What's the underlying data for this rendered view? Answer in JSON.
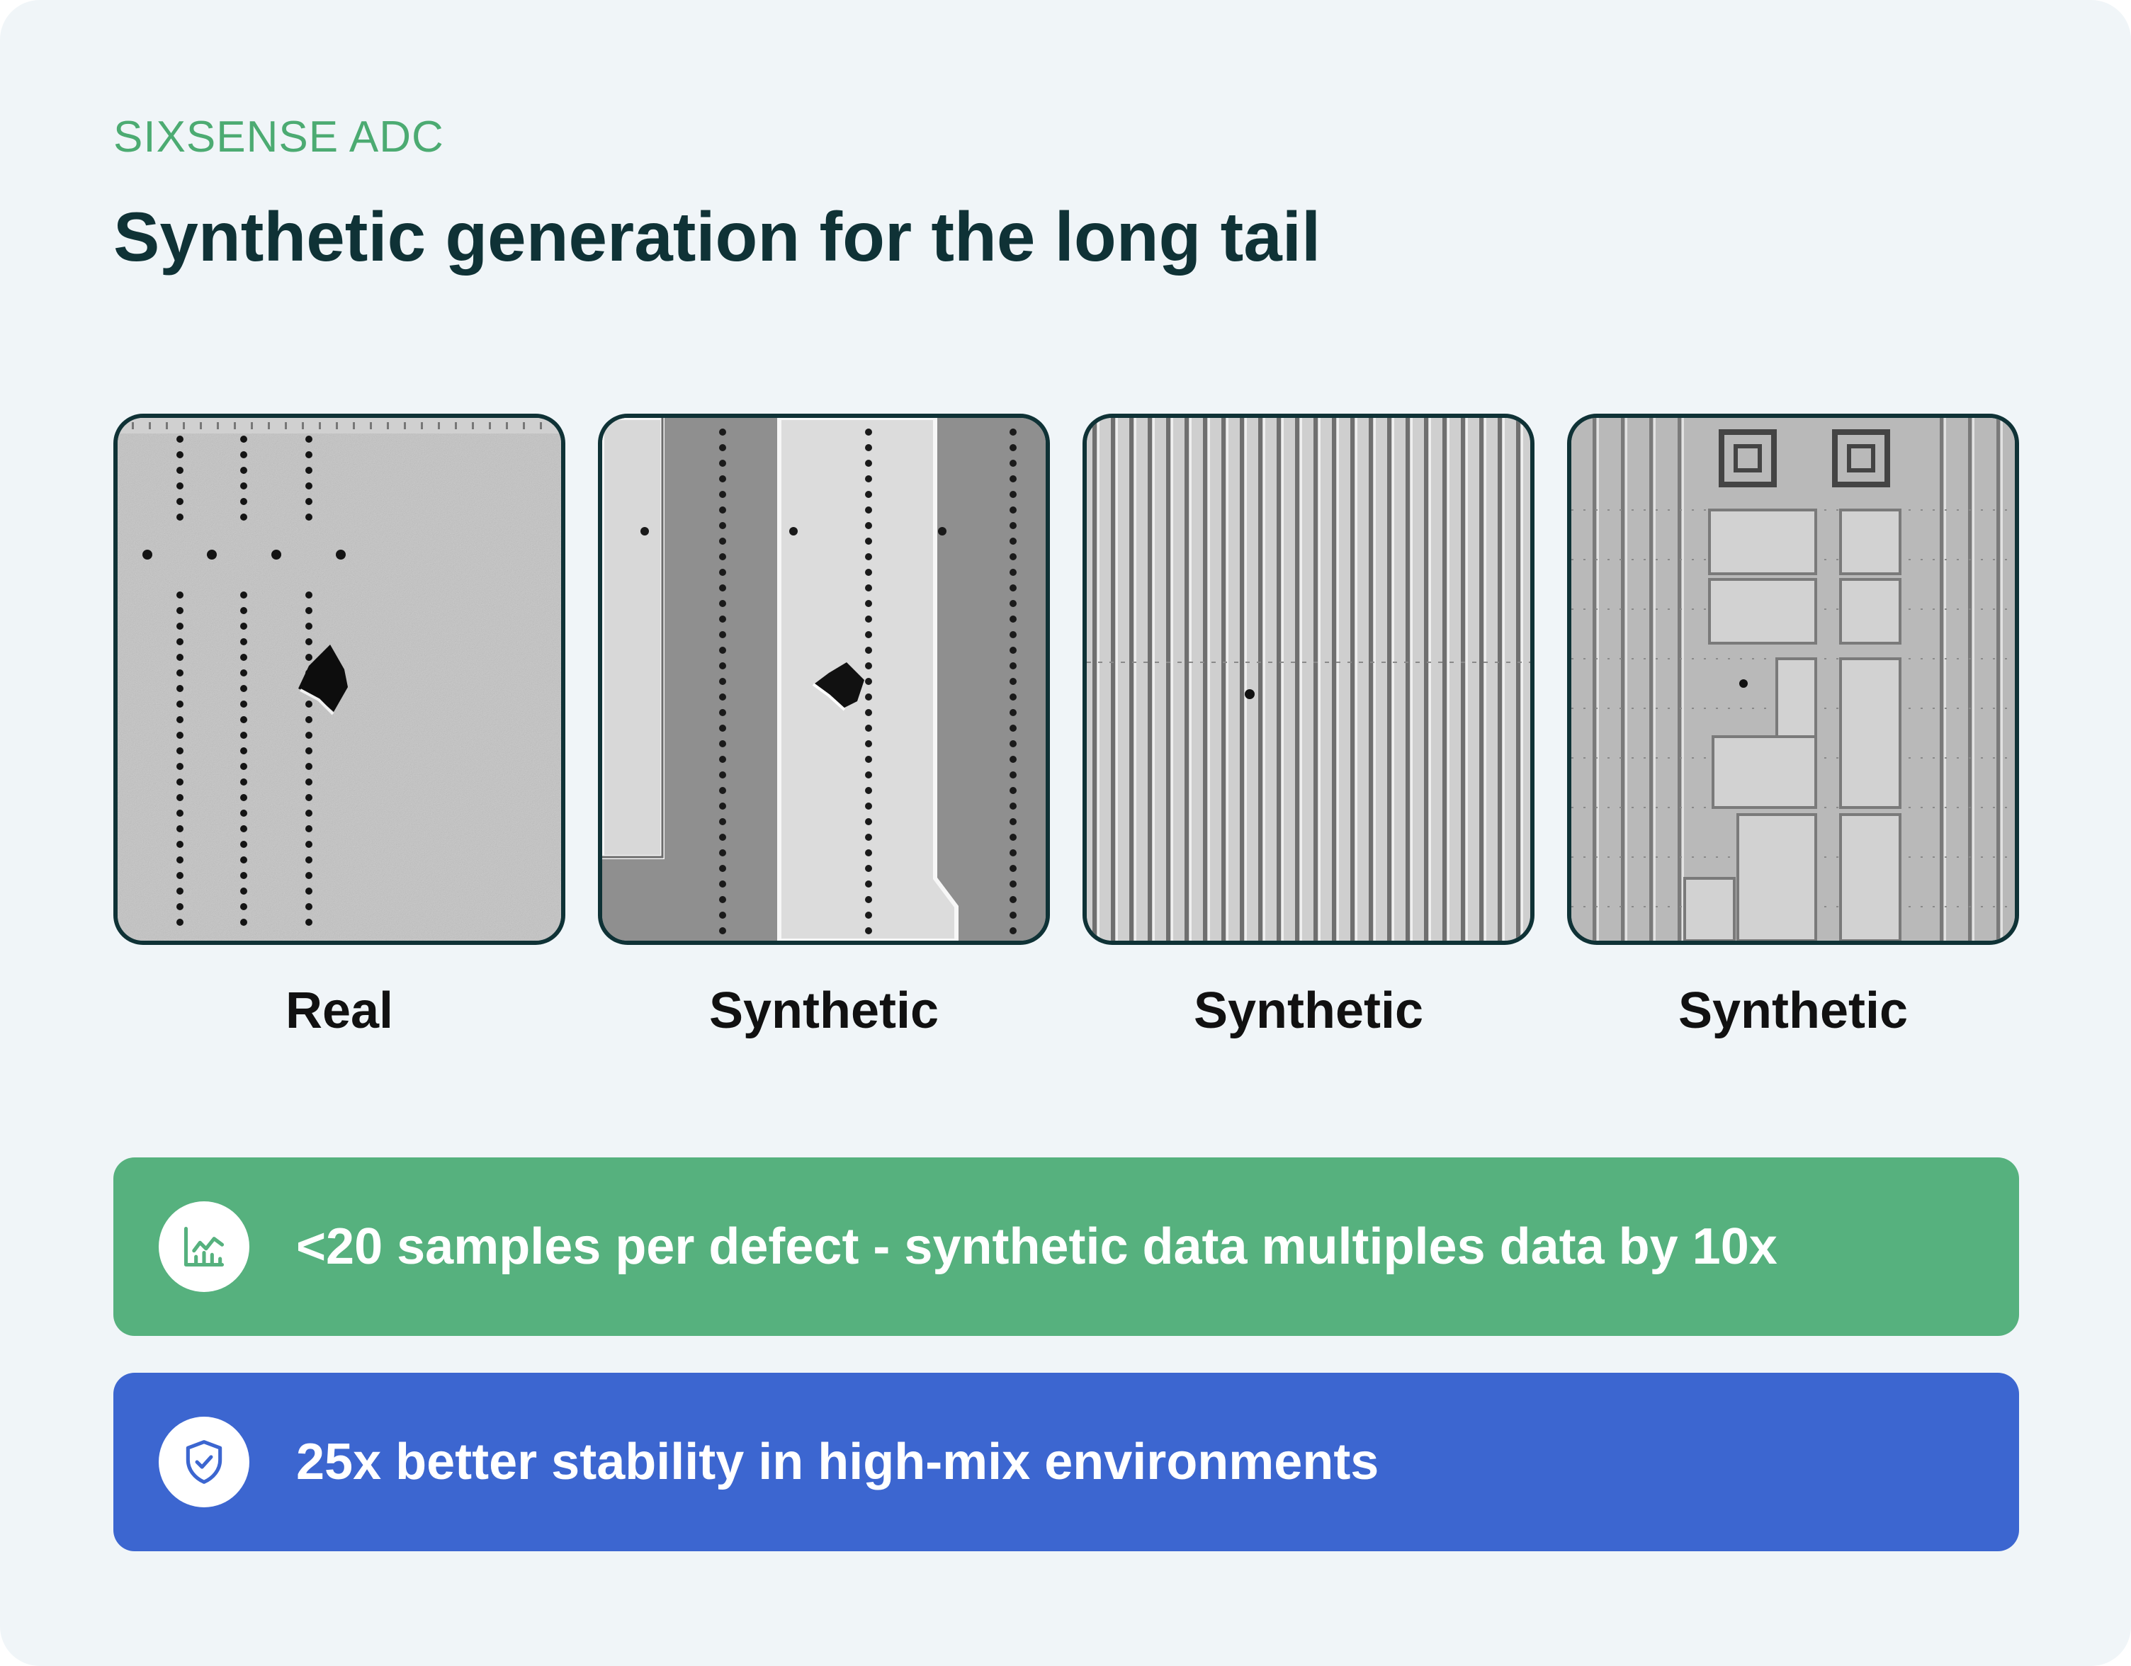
{
  "header": {
    "eyebrow": "SIXSENSE ADC",
    "title": "Synthetic generation for the long tail"
  },
  "gallery": {
    "items": [
      {
        "caption": "Real"
      },
      {
        "caption": "Synthetic"
      },
      {
        "caption": "Synthetic"
      },
      {
        "caption": "Synthetic"
      }
    ]
  },
  "highlights": [
    {
      "icon": "chart-icon",
      "text": "<20 samples per defect - synthetic data multiples data by 10x",
      "color": "#56b17e"
    },
    {
      "icon": "shield-check-icon",
      "text": "25x better stability in high-mix environments",
      "color": "#3c66d0"
    }
  ],
  "colors": {
    "eyebrow": "#4cab72",
    "title": "#0f3236",
    "card_background": "#f0f5f8"
  }
}
